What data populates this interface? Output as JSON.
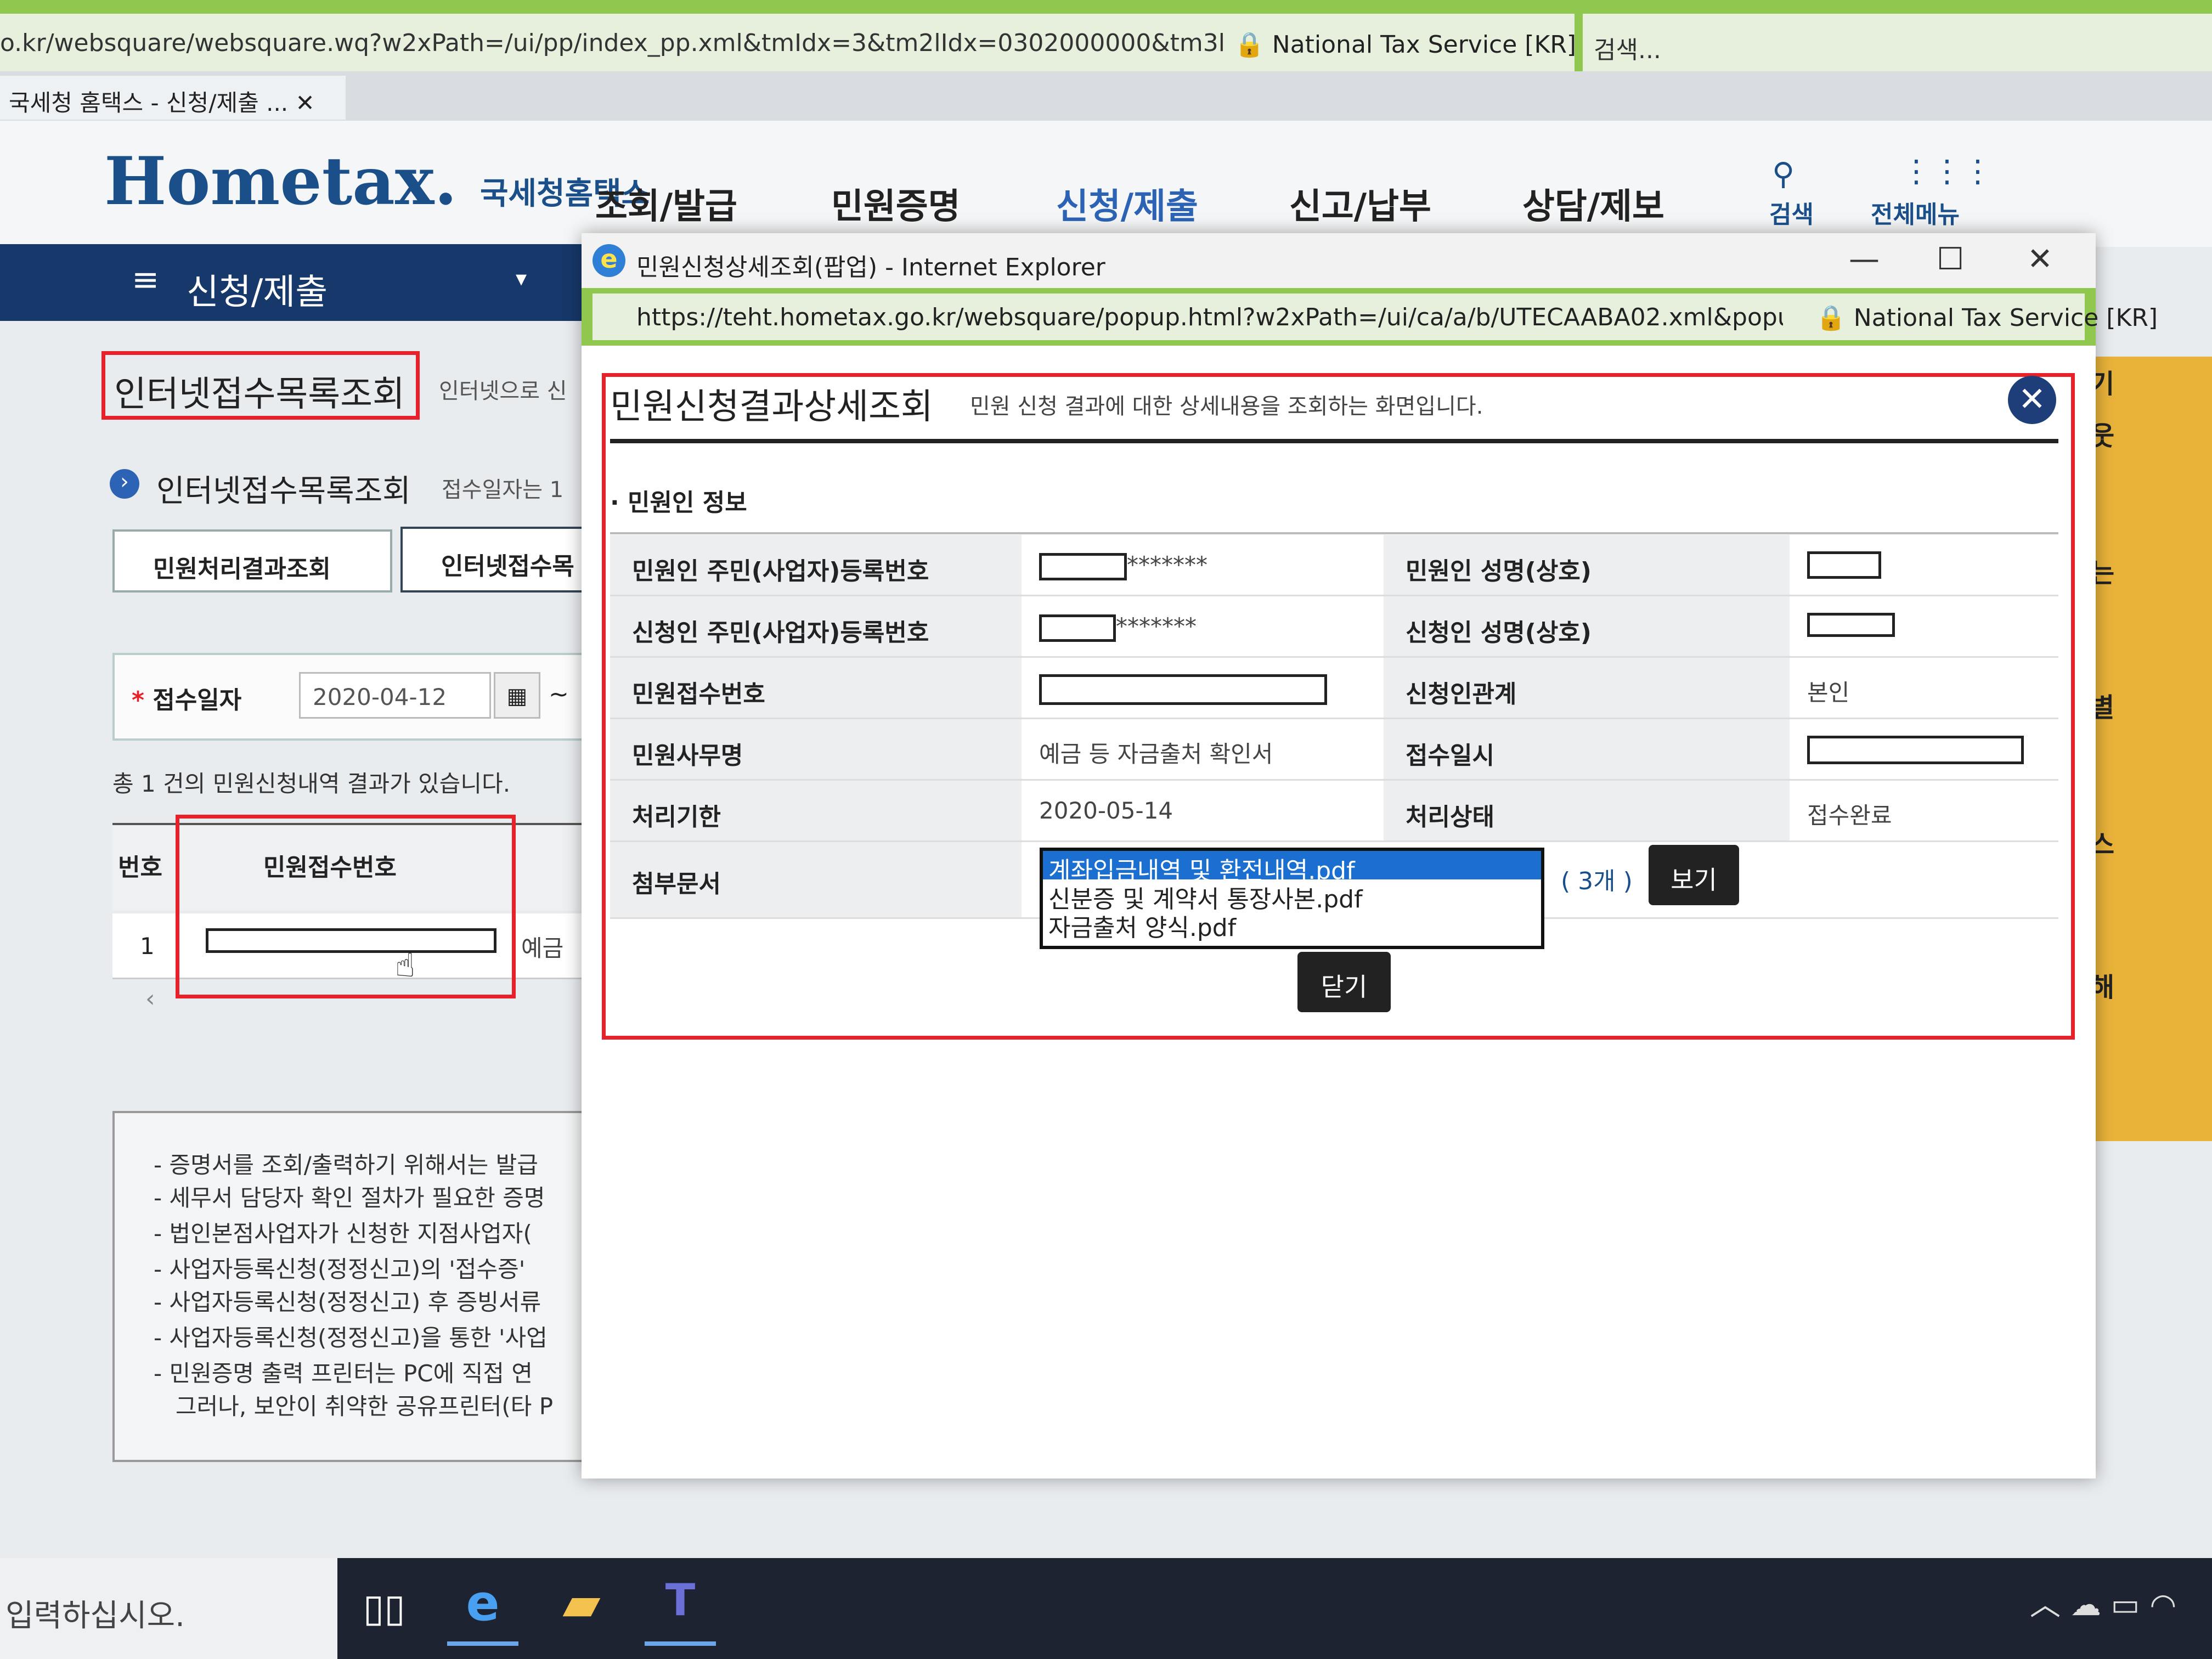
{
  "browser": {
    "url": "o.kr/websquare/websquare.wq?w2xPath=/ui/pp/index_pp.xml&tmIdx=3&tm2lIdx=0302000000&tm3lIdx=",
    "site_identity": "National Tax Service [KR]",
    "search_placeholder": "검색...",
    "tab_title": "국세청 홈택스 - 신청/제출 ..."
  },
  "site": {
    "logo_text": "Hometax.",
    "logo_sub": "국세청홈택스",
    "nav": [
      "조회/발급",
      "민원증명",
      "신청/제출",
      "신고/납부",
      "상담/제보"
    ],
    "search_label": "검색",
    "allmenu_label": "전체메뉴",
    "breadcrumb_menu": "신청/제출"
  },
  "page": {
    "title": "인터넷접수목록조회",
    "subtitle": "인터넷으로 신",
    "section_title": "인터넷접수목록조회",
    "section_note": "접수일자는 1",
    "tabs": [
      "민원처리결과조회",
      "인터넷접수목"
    ],
    "filter_label": "접수일자",
    "filter_date": "2020-04-12",
    "filter_tilde": "~",
    "result_count_text": "총 1 건의 민원신청내역 결과가 있습니다.",
    "table_headers": [
      "번호",
      "민원접수번호"
    ],
    "rows": [
      {
        "no": "1",
        "extra": "예금"
      }
    ],
    "notices": [
      "- 증명서를 조회/출력하기 위해서는 발급",
      "- 세무서 담당자 확인 절차가 필요한 증명",
      "- 법인본점사업자가 신청한 지점사업자(",
      "- 사업자등록신청(정정신고)의 '접수증'",
      "- 사업자등록신청(정정신고) 후 증빙서류",
      "- 사업자등록신청(정정신고)을 통한 '사업",
      "- 민원증명 출력 프린터는 PC에 직접 연",
      "그러나, 보안이 취약한 공유프린터(타 P"
    ],
    "right_fragments": [
      "기",
      "웃",
      "는",
      "별",
      "스",
      "해"
    ]
  },
  "popup": {
    "window_title": "민원신청상세조회(팝업) - Internet Explorer",
    "url": "https://teht.hometax.go.kr/websquare/popup.html?w2xPath=/ui/ca/a/b/UTECAABA02.xml&popupID=cvaAp",
    "site_identity": "National Tax Service [KR]",
    "title": "민원신청결과상세조회",
    "description": "민원 신청 결과에 대한 상세내용을 조회하는 화면입니다.",
    "info_header": "민원인 정보",
    "labels": {
      "applicant_id": "민원인 주민(사업자)등록번호",
      "applicant_name": "민원인 성명(상호)",
      "requester_id": "신청인 주민(사업자)등록번호",
      "requester_name": "신청인 성명(상호)",
      "receipt_no": "민원접수번호",
      "relation": "신청인관계",
      "service_name": "민원사무명",
      "received_at": "접수일시",
      "deadline": "처리기한",
      "status": "처리상태",
      "attachments": "첨부문서"
    },
    "values": {
      "applicant_id_mask": "*******",
      "requester_id_mask": "*******",
      "relation": "본인",
      "service_name": "예금 등 자금출처 확인서",
      "deadline": "2020-05-14",
      "status": "접수완료"
    },
    "attachments": [
      "계좌입금내역 및 환전내역.pdf",
      "신분증 및 계약서 통장사본.pdf",
      "자금출처 양식.pdf"
    ],
    "attachment_count": "( 3개 )",
    "view_button": "보기",
    "close_button": "닫기"
  },
  "taskbar": {
    "search_placeholder": "입력하십시오.",
    "apps": [
      "task-view",
      "internet-explorer",
      "file-explorer",
      "teams"
    ]
  },
  "colors": {
    "address_bar": "#8fc74f",
    "nav_blue": "#16386a",
    "highlight_red": "#e8202a",
    "accent_bar": "#e9b33a"
  }
}
